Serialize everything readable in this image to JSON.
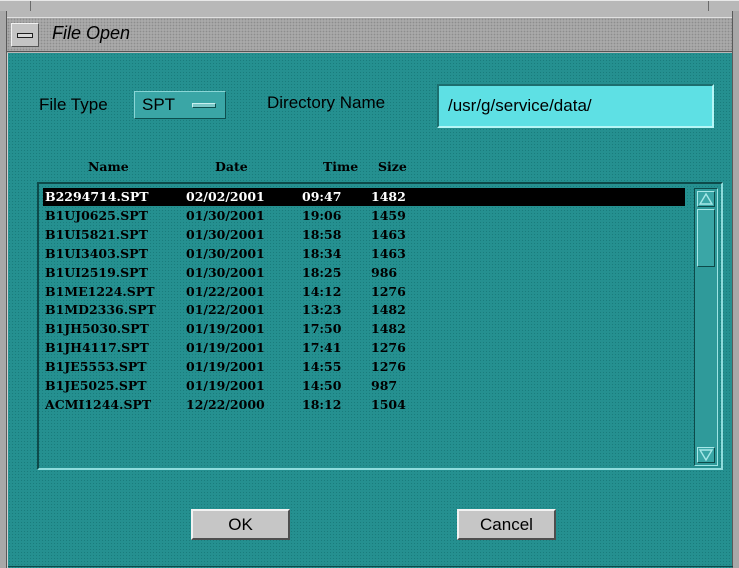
{
  "window": {
    "title": "File Open"
  },
  "form": {
    "file_type_label": "File Type",
    "file_type_value": "SPT",
    "directory_label": "Directory Name",
    "directory_value": "/usr/g/service/data/"
  },
  "columns": {
    "name": "Name",
    "date": "Date",
    "time": "Time",
    "size": "Size"
  },
  "files": [
    {
      "name": "B2294714.SPT",
      "date": "02/02/2001",
      "time": "09:47",
      "size": "1482",
      "selected": true
    },
    {
      "name": "B1UJ0625.SPT",
      "date": "01/30/2001",
      "time": "19:06",
      "size": "1459"
    },
    {
      "name": "B1UI5821.SPT",
      "date": "01/30/2001",
      "time": "18:58",
      "size": "1463"
    },
    {
      "name": "B1UI3403.SPT",
      "date": "01/30/2001",
      "time": "18:34",
      "size": "1463"
    },
    {
      "name": "B1UI2519.SPT",
      "date": "01/30/2001",
      "time": "18:25",
      "size": "986"
    },
    {
      "name": "B1ME1224.SPT",
      "date": "01/22/2001",
      "time": "14:12",
      "size": "1276"
    },
    {
      "name": "B1MD2336.SPT",
      "date": "01/22/2001",
      "time": "13:23",
      "size": "1482"
    },
    {
      "name": "B1JH5030.SPT",
      "date": "01/19/2001",
      "time": "17:50",
      "size": "1482"
    },
    {
      "name": "B1JH4117.SPT",
      "date": "01/19/2001",
      "time": "17:41",
      "size": "1276"
    },
    {
      "name": "B1JE5553.SPT",
      "date": "01/19/2001",
      "time": "14:55",
      "size": "1276"
    },
    {
      "name": "B1JE5025.SPT",
      "date": "01/19/2001",
      "time": "14:50",
      "size": "987"
    },
    {
      "name": "ACMI1244.SPT",
      "date": "12/22/2000",
      "time": "18:12",
      "size": "1504"
    }
  ],
  "buttons": {
    "ok": "OK",
    "cancel": "Cancel"
  },
  "icons": {
    "window_menu": "window-menu-icon",
    "option_menu_indicator": "option-menu-indicator-icon",
    "scroll_up": "scroll-up-arrow-icon",
    "scroll_down": "scroll-down-arrow-icon"
  },
  "colors": {
    "dialog_background": "#259090",
    "directory_field": "#5ee0e4",
    "selection": "#000000",
    "button": "#c6c6c6"
  }
}
